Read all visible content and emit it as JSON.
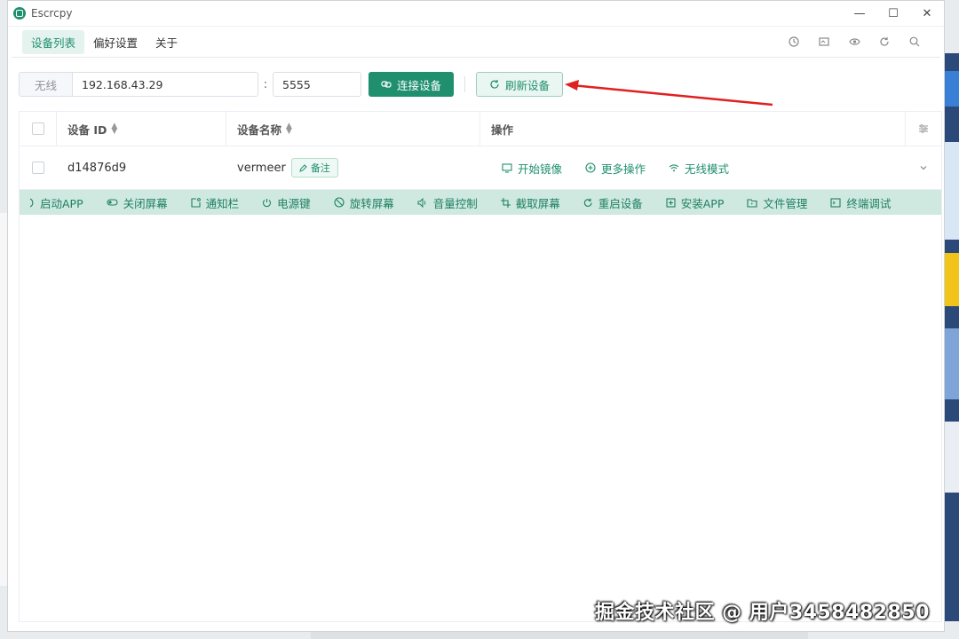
{
  "window": {
    "title": "Escrcpy"
  },
  "tabs": [
    {
      "label": "设备列表",
      "active": true
    },
    {
      "label": "偏好设置",
      "active": false
    },
    {
      "label": "关于",
      "active": false
    }
  ],
  "toolbar_icons": [
    "clock-icon",
    "screen-icon",
    "eye-icon",
    "refresh-icon",
    "search-icon"
  ],
  "connect": {
    "wireless_label": "无线",
    "ip_value": "192.168.43.29",
    "colon": ":",
    "port_value": "5555",
    "connect_label": "连接设备",
    "refresh_label": "刷新设备"
  },
  "table": {
    "headers": {
      "id": "设备 ID",
      "name": "设备名称",
      "ops": "操作"
    },
    "rows": [
      {
        "id": "d14876d9",
        "name": "vermeer",
        "remark": "备注"
      }
    ],
    "ops": [
      "开始镜像",
      "更多操作",
      "无线模式"
    ]
  },
  "actions": [
    "启动APP",
    "关闭屏幕",
    "通知栏",
    "电源键",
    "旋转屏幕",
    "音量控制",
    "截取屏幕",
    "重启设备",
    "安装APP",
    "文件管理",
    "终端调试"
  ],
  "watermark": "掘金技术社区 @ 用户3458482850",
  "colors": {
    "accent": "#1f8f6e",
    "action_bar": "#cfe9e0",
    "annotation": "#e02020"
  }
}
